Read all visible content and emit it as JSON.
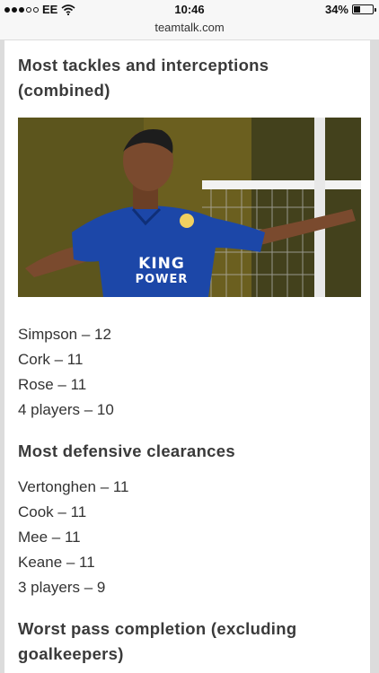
{
  "status_bar": {
    "carrier": "EE",
    "time": "10:46",
    "battery_percent_label": "34%",
    "battery_level": 0.34
  },
  "browser": {
    "url": "teamtalk.com"
  },
  "article": {
    "sections": [
      {
        "title": "Most tackles and interceptions (combined)",
        "items": [
          "Simpson – 12",
          "Cork – 11",
          "Rose – 11",
          "4 players – 10"
        ]
      },
      {
        "title": "Most defensive clearances",
        "items": [
          "Vertonghen – 11",
          "Cook – 11",
          "Mee – 11",
          "Keane – 11",
          "3 players – 9"
        ]
      },
      {
        "title": "Worst pass completion (excluding goalkeepers)"
      }
    ],
    "photo": {
      "shirt_sponsor_line1": "KING",
      "shirt_sponsor_line2": "POWER",
      "colors": {
        "shirt": "#1c47a8",
        "skin": "#7a4a2e",
        "grass": "#8c7a22",
        "post": "#f2f2f2"
      }
    }
  }
}
